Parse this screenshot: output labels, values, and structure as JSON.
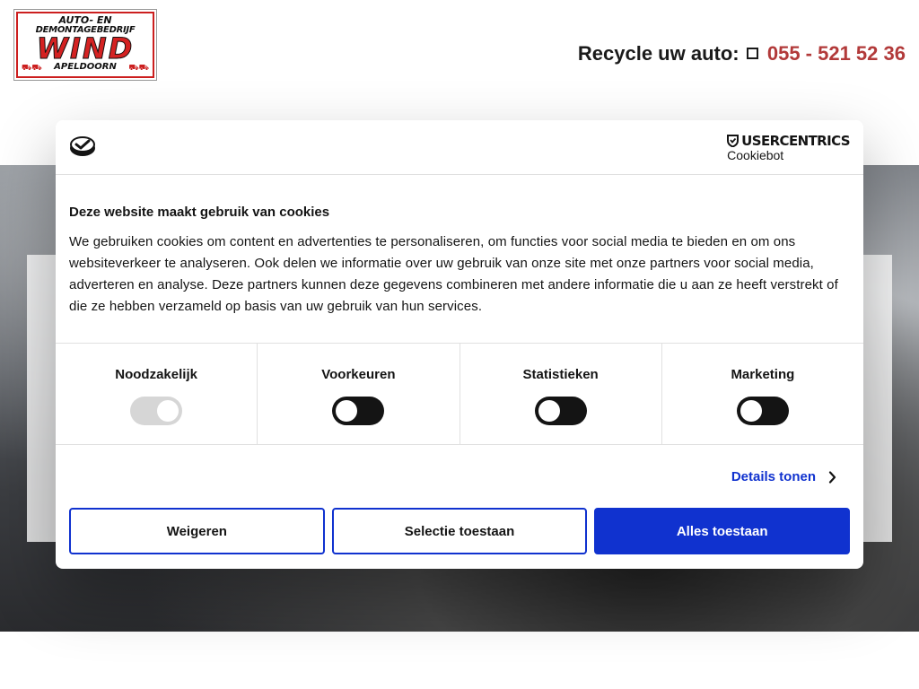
{
  "header": {
    "logo": {
      "line1": "AUTO- EN",
      "line2": "DEMONTAGEBEDRIJF",
      "name": "WIND",
      "line3": "APELDOORN"
    },
    "recycle_label": "Recycle uw auto:",
    "phone": "055 - 521 52 36"
  },
  "cookie_dialog": {
    "brand_name": "USERCENTRICS",
    "brand_sub": "Cookiebot",
    "title": "Deze website maakt gebruik van cookies",
    "text": "We gebruiken cookies om content en advertenties te personaliseren, om functies voor social media te bieden en om ons websiteverkeer te analyseren. Ook delen we informatie over uw gebruik van onze site met onze partners voor social media, adverteren en analyse. Deze partners kunnen deze gegevens combineren met andere informatie die u aan ze heeft verstrekt of die ze hebben verzameld op basis van uw gebruik van hun services.",
    "toggles": [
      {
        "label": "Noodzakelijk",
        "enabled": true,
        "disabled": true
      },
      {
        "label": "Voorkeuren",
        "enabled": false,
        "disabled": false
      },
      {
        "label": "Statistieken",
        "enabled": false,
        "disabled": false
      },
      {
        "label": "Marketing",
        "enabled": false,
        "disabled": false
      }
    ],
    "details_label": "Details tonen",
    "buttons": {
      "reject": "Weigeren",
      "selection": "Selectie toestaan",
      "accept_all": "Alles toestaan"
    },
    "colors": {
      "accent": "#1032cf",
      "phone": "#b23a3a",
      "logo_red": "#d42222"
    },
    "icons": {
      "logo": "cookie-logo-icon",
      "brand": "shield-icon",
      "details": "chevron-right-icon",
      "phone": "phone-icon"
    }
  }
}
